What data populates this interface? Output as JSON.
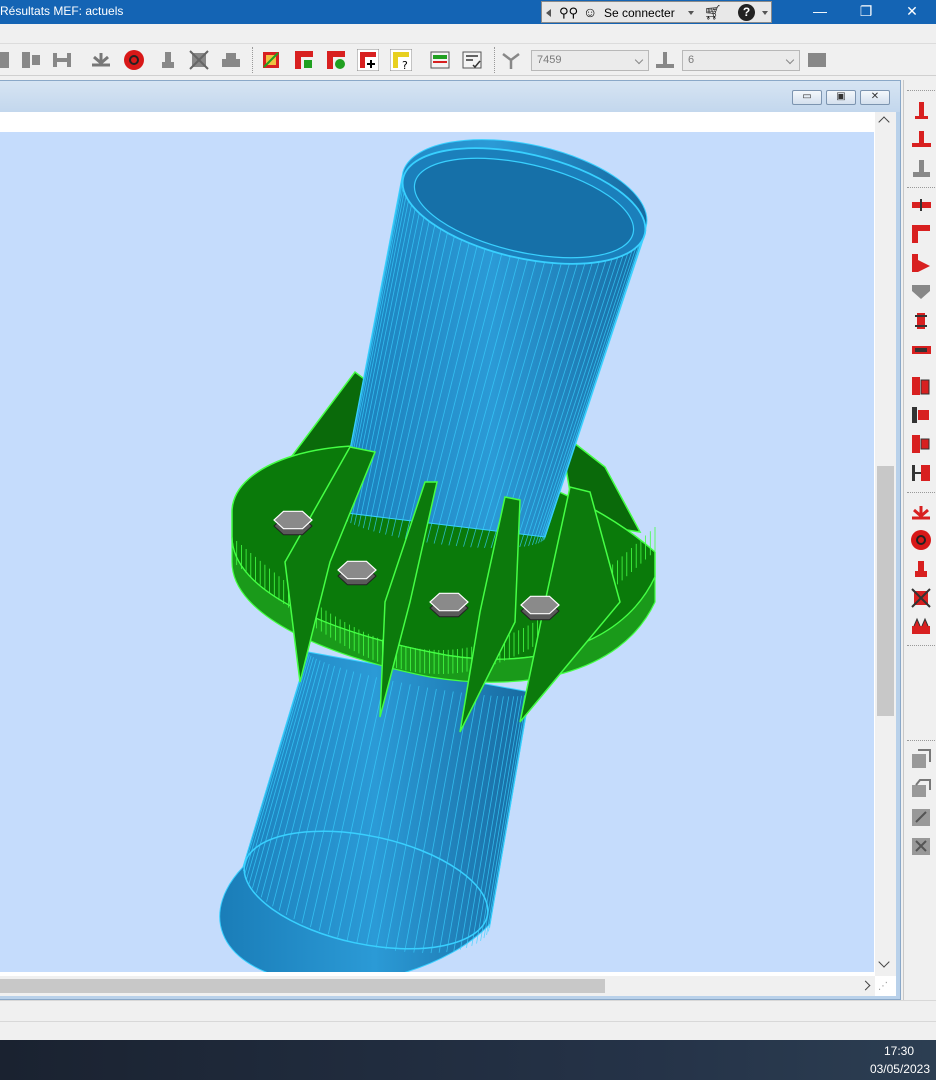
{
  "window": {
    "title": "Résultats MEF: actuels",
    "minimize_glyph": "—",
    "restore_glyph": "❐",
    "close_glyph": "✕"
  },
  "online": {
    "connect_label": "Se connecter",
    "help_glyph": "?"
  },
  "toolbar": {
    "combo1_value": "7459",
    "combo2_value": "6"
  },
  "child_window": {
    "minimize_glyph": "▭",
    "restore_glyph": "▣",
    "close_glyph": "✕"
  },
  "model": {
    "tube_color": "#1e8cc8",
    "tube_mesh_color": "#38d0ff",
    "plate_color": "#0c7a0c",
    "plate_edge_color": "#44ff44",
    "bolt_color": "#8a8a8a",
    "background_color": "#c5dcfc"
  },
  "taskbar": {
    "time": "17:30",
    "date": "03/05/2023"
  }
}
